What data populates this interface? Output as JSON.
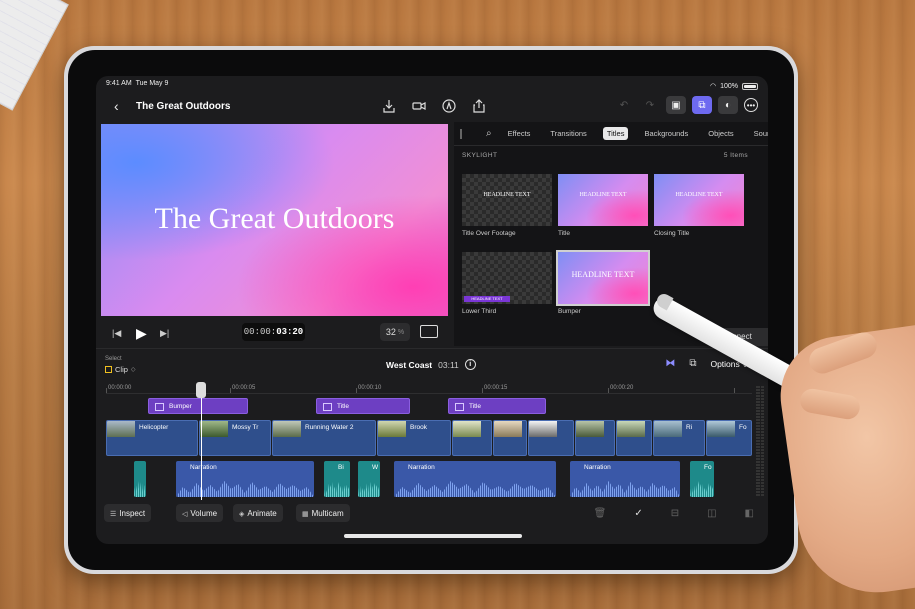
{
  "status": {
    "time": "9:41 AM",
    "date": "Tue May 9",
    "battery": "100%"
  },
  "project": {
    "title": "The Great Outdoors",
    "back_icon": "chevron-left-icon"
  },
  "viewer": {
    "title_text": "The Great Outdoors",
    "timecode_prefix": "00:00:",
    "timecode_main": "03:20",
    "zoom_value": "32",
    "zoom_unit": "%"
  },
  "browser": {
    "categories": [
      "Effects",
      "Transitions",
      "Titles",
      "Backgrounds",
      "Objects",
      "Soundtracks"
    ],
    "selected_category": "Titles",
    "section": "SKYLIGHT",
    "item_count": "5 Items",
    "items": [
      {
        "label": "Title Over Footage",
        "thumb_text": "HEADLINE TEXT"
      },
      {
        "label": "Title",
        "thumb_text": "HEADLINE TEXT"
      },
      {
        "label": "Closing Title",
        "thumb_text": "HEADLINE TEXT"
      },
      {
        "label": "Lower Third",
        "thumb_text": "HEADLINE TEXT"
      },
      {
        "label": "Bumper",
        "thumb_text": "HEADLINE TEXT"
      }
    ],
    "connect_label": "Connect"
  },
  "timeline": {
    "select_label": "Select",
    "clip_label": "Clip",
    "name": "West Coast",
    "duration": "03:11",
    "options_label": "Options",
    "ruler": [
      "00:00:00",
      "00:00:05",
      "00:00:10",
      "00:00:15",
      "00:00:20"
    ],
    "title_clips": [
      "Bumper",
      "Title",
      "Title"
    ],
    "video_clips": [
      "Helicopter",
      "Mossy Tr",
      "Running Water 2",
      "Brook",
      "Ri",
      "Fo"
    ],
    "audio_clips": [
      "Narration",
      "Bi",
      "W",
      "Narration",
      "Narration",
      "Fo"
    ]
  },
  "bottom_bar": {
    "inspect": "Inspect",
    "volume": "Volume",
    "animate": "Animate",
    "multicam": "Multicam"
  },
  "colors": {
    "accent": "#6e6af0",
    "title_clip": "#6d3fc2",
    "video_clip": "#2f4f8c",
    "audio_clip": "#3a58a8",
    "teal_audio": "#1e8a8a"
  }
}
